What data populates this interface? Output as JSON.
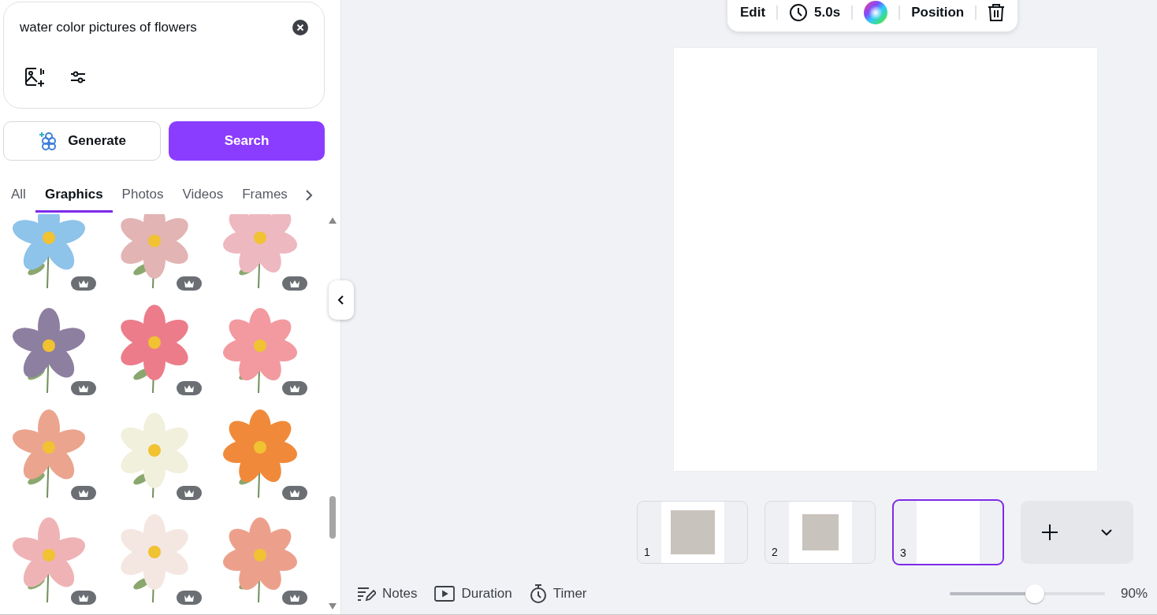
{
  "search": {
    "value": "water color pictures of flowers"
  },
  "buttons": {
    "generate": "Generate",
    "search": "Search"
  },
  "tabs": [
    {
      "label": "All",
      "selected": false
    },
    {
      "label": "Graphics",
      "selected": true
    },
    {
      "label": "Photos",
      "selected": false
    },
    {
      "label": "Videos",
      "selected": false
    },
    {
      "label": "Frames",
      "selected": false
    }
  ],
  "graphics": [
    {
      "color": "#8ec3ea",
      "premium": true
    },
    {
      "color": "#e2b4b4",
      "premium": true
    },
    {
      "color": "#eeb8c0",
      "premium": true
    },
    {
      "color": "#8d7fa0",
      "premium": true
    },
    {
      "color": "#ec7c8a",
      "premium": true
    },
    {
      "color": "#f29aa0",
      "premium": true
    },
    {
      "color": "#eba48e",
      "premium": true
    },
    {
      "color": "#f1f0dc",
      "premium": true
    },
    {
      "color": "#f08a3a",
      "premium": true
    },
    {
      "color": "#efb3b6",
      "premium": true
    },
    {
      "color": "#f4e6e0",
      "premium": true
    },
    {
      "color": "#eca08c",
      "premium": true
    }
  ],
  "toolbar": {
    "edit": "Edit",
    "duration": "5.0s",
    "position": "Position"
  },
  "pages": [
    {
      "number": "1",
      "selected": false
    },
    {
      "number": "2",
      "selected": false
    },
    {
      "number": "3",
      "selected": true
    }
  ],
  "footer": {
    "notes": "Notes",
    "duration": "Duration",
    "timer": "Timer",
    "zoom": {
      "level": 0.55,
      "reading": "90%"
    }
  }
}
